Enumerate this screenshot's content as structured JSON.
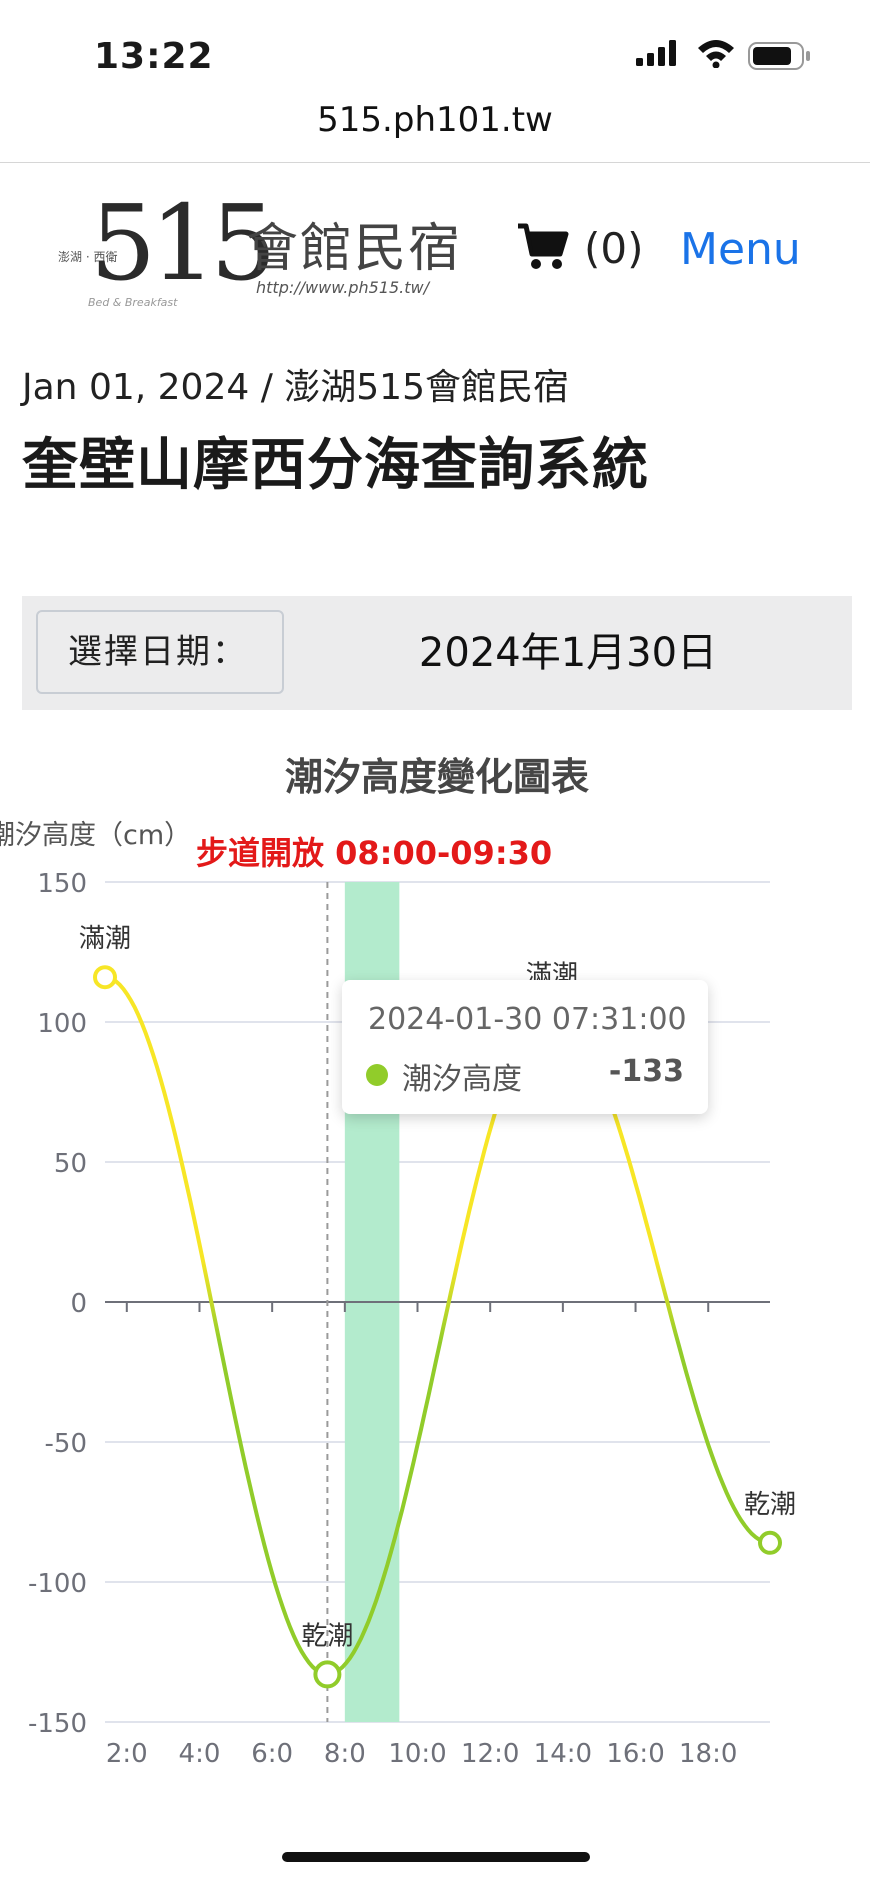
{
  "status_bar": {
    "time": "13:22"
  },
  "browser": {
    "url": "515.ph101.tw"
  },
  "header": {
    "logo": {
      "number": "515",
      "small_text": "澎湖 · 西衛",
      "name": "會館民宿",
      "url": "http://www.ph515.tw/",
      "tagline": "Bed & Breakfast"
    },
    "cart_count": "(0)",
    "menu_label": "Menu"
  },
  "breadcrumb": "Jan 01, 2024 / 澎湖515會館民宿",
  "page_title": "奎壁山摩西分海查詢系統",
  "date_selector": {
    "label": "選擇日期：",
    "value": "2024年1月30日"
  },
  "colors": {
    "accent_link": "#1a73e8",
    "walkway_band": "#b3ebcd",
    "line_high": "#f7e626",
    "line_low": "#91cc2a",
    "open_text": "#e31919"
  },
  "chart_data": {
    "type": "line",
    "title": "潮汐高度變化圖表",
    "ylabel": "潮汐高度（cm）",
    "xlabel": "",
    "ylim": [
      -150,
      150
    ],
    "yticks": [
      150,
      100,
      50,
      0,
      -50,
      -100,
      -150
    ],
    "xlim": [
      1.4,
      19.7
    ],
    "xtick_labels": [
      "2:0",
      "4:0",
      "6:0",
      "8:0",
      "10:0",
      "12:0",
      "14:0",
      "16:0",
      "18:0"
    ],
    "xtick_positions": [
      2,
      4,
      6,
      8,
      10,
      12,
      14,
      16,
      18
    ],
    "series": [
      {
        "name": "潮汐高度",
        "extrema": [
          {
            "x": 1.4,
            "y": 116,
            "label": "滿潮"
          },
          {
            "x": 7.52,
            "y": -133,
            "label": "乾潮"
          },
          {
            "x": 13.7,
            "y": 103,
            "label": "滿潮"
          },
          {
            "x": 19.7,
            "y": -86,
            "label": "乾潮"
          }
        ]
      }
    ],
    "walkway_open": {
      "label": "步道開放 08:00-09:30",
      "start": 8.0,
      "end": 9.5
    },
    "cursor_x": 7.52,
    "tooltip": {
      "time": "2024-01-30 07:31:00",
      "series": "潮汐高度",
      "value": "-133"
    }
  }
}
